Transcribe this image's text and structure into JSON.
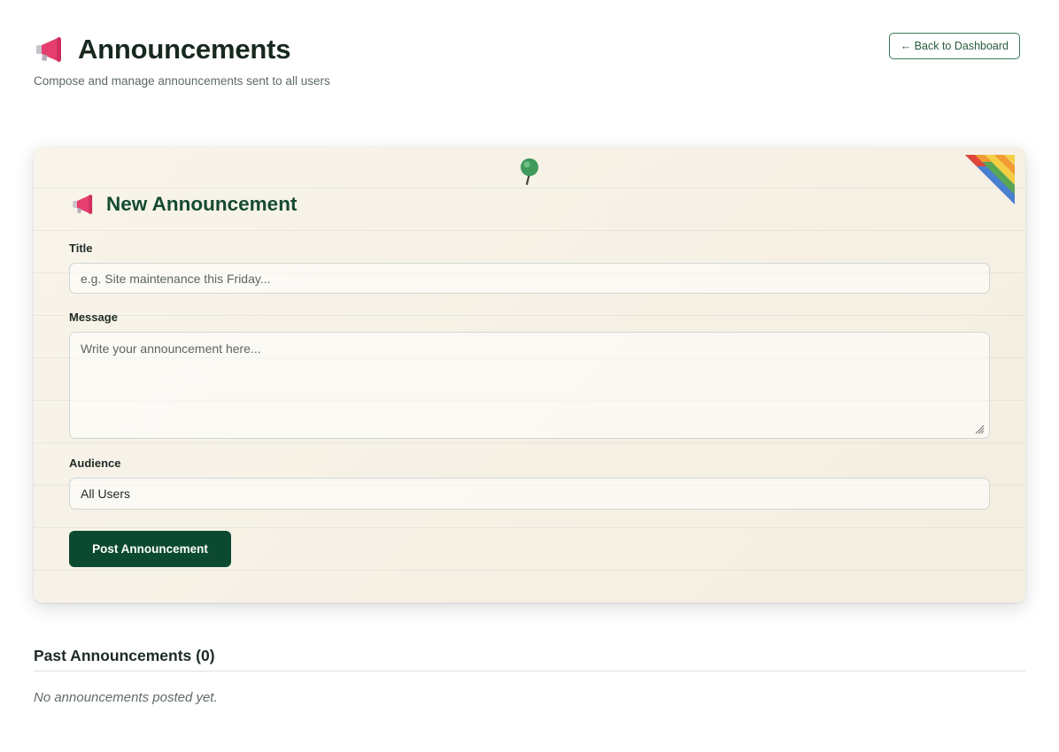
{
  "header": {
    "title": "Announcements",
    "subtitle": "Compose and manage announcements sent to all users",
    "back_button_label": "← Back to Dashboard",
    "icon": "megaphone-icon"
  },
  "form": {
    "heading": "New Announcement",
    "heading_icon": "megaphone-icon",
    "title_label": "Title",
    "title_placeholder": "e.g. Site maintenance this Friday...",
    "message_label": "Message",
    "message_placeholder": "Write your announcement here...",
    "audience_label": "Audience",
    "audience_value": "All Users",
    "submit_label": "Post Announcement"
  },
  "past": {
    "heading": "Past Announcements (0)",
    "empty_text": "No announcements posted yet."
  },
  "colors": {
    "brand_green": "#0b4a30",
    "card_background": "#f6f1e6",
    "corner_ribbon": [
      "#e2453a",
      "#f29a34",
      "#f3cf44",
      "#5aa655",
      "#4a7ed0"
    ]
  }
}
